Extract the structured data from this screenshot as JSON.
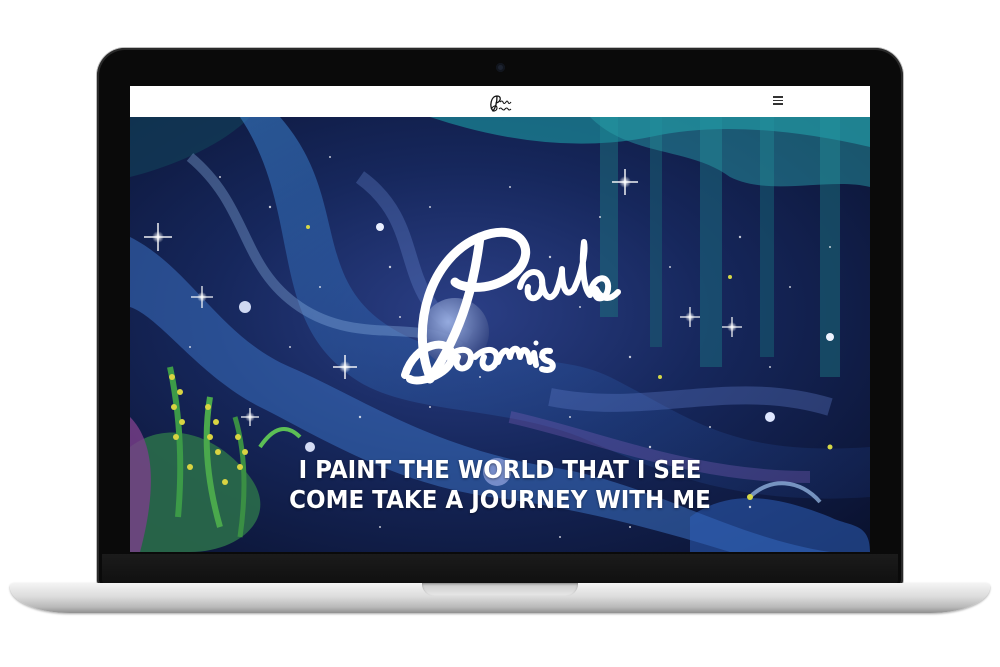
{
  "site": {
    "logo_text": "Paula Loomis",
    "tagline_line1": "I PAINT THE WORLD THAT I SEE",
    "tagline_line2": "COME TAKE A JOURNEY WITH ME"
  },
  "nav": {
    "menu_icon": "hamburger-menu-icon"
  },
  "colors": {
    "topbar": "#ffffff",
    "hero_base": "#0d1a3b",
    "hero_teal": "#1f8a9a",
    "hero_blue": "#2d5fb0",
    "hero_purple": "#5a3f8c",
    "moon_yellow": "#c7d94a",
    "text": "#ffffff"
  }
}
